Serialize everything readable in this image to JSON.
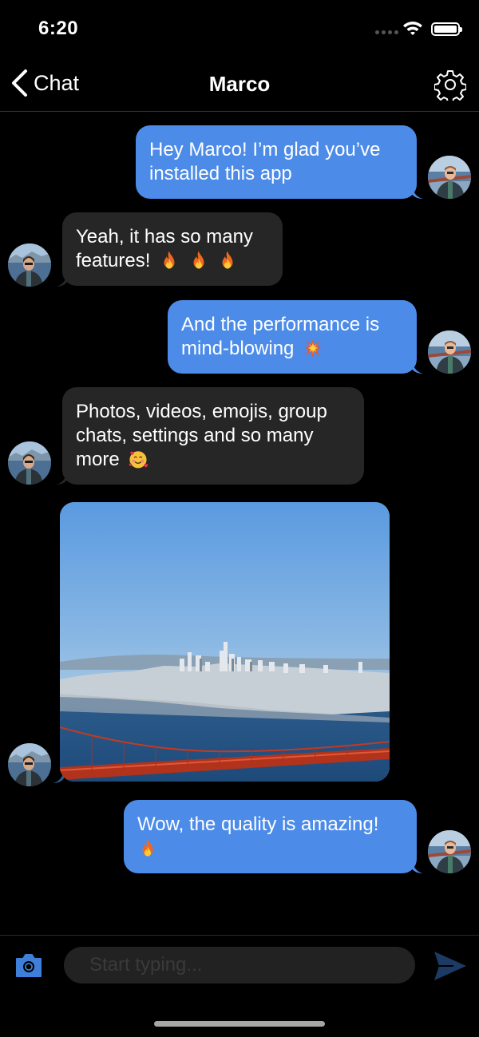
{
  "status_bar": {
    "time": "6:20"
  },
  "nav": {
    "back_label": "Chat",
    "title": "Marco"
  },
  "messages": [
    {
      "id": 1,
      "direction": "outgoing",
      "text": "Hey Marco! I’m glad you’ve installed this app"
    },
    {
      "id": 2,
      "direction": "incoming",
      "text": "Yeah, it has so many features!",
      "emoji": [
        "fire",
        "fire",
        "fire"
      ]
    },
    {
      "id": 3,
      "direction": "outgoing",
      "text": "And the performance is mind-blowing",
      "emoji": [
        "collision"
      ]
    },
    {
      "id": 4,
      "direction": "incoming",
      "text": "Photos, videos, emojis, group chats, settings and so many more",
      "emoji": [
        "smiling-face-with-hearts"
      ]
    },
    {
      "id": 5,
      "direction": "incoming",
      "type": "photo",
      "photo_subject": "San Francisco skyline and Golden Gate Bridge"
    },
    {
      "id": 6,
      "direction": "outgoing",
      "text": "Wow, the quality is amazing!",
      "emoji": [
        "fire"
      ]
    }
  ],
  "composer": {
    "placeholder": "Start typing..."
  },
  "colors": {
    "outgoing_bubble": "#4c8ce8",
    "incoming_bubble": "#262626",
    "accent": "#3d7fd9",
    "background": "#000000"
  },
  "icons": [
    "back-chevron-icon",
    "settings-gear-icon",
    "camera-icon",
    "send-icon",
    "wifi-icon",
    "battery-icon"
  ]
}
